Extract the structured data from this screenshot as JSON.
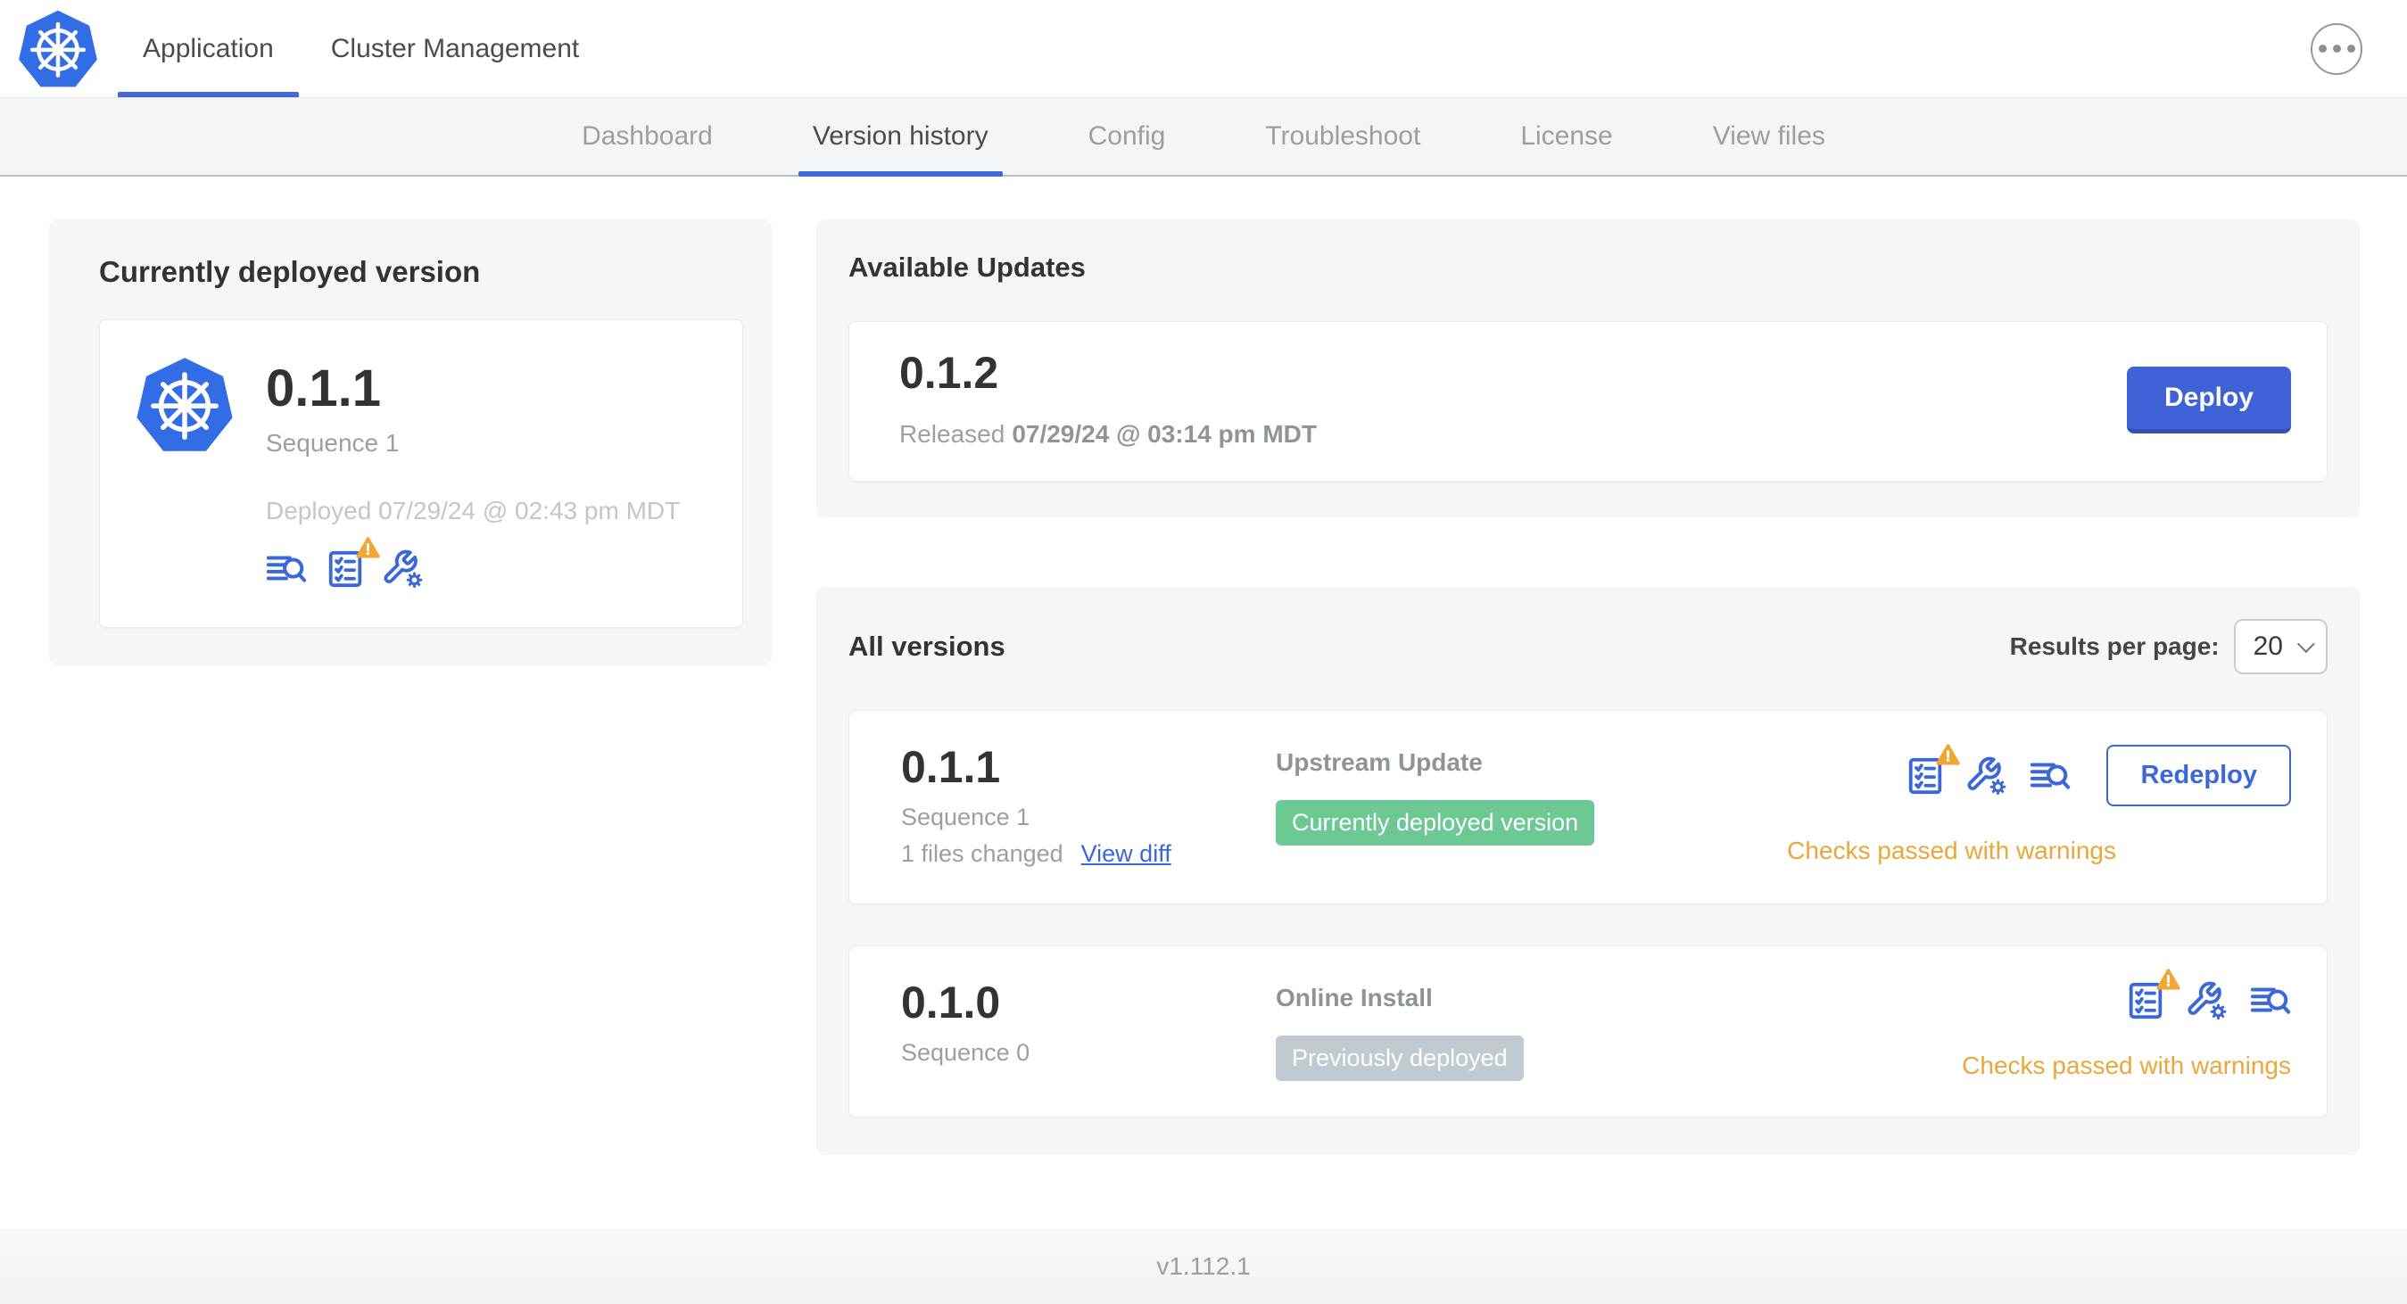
{
  "colors": {
    "accent_blue": "#3b68d9",
    "logo_blue": "#326de6",
    "warning_orange": "#eba63c",
    "triangle_orange": "#f0a733",
    "badge_green": "#6dc993",
    "badge_gray": "#c1cad0",
    "panel_gray": "#f5f6f8"
  },
  "header": {
    "tabs": [
      {
        "label": "Application",
        "active": true
      },
      {
        "label": "Cluster Management",
        "active": false
      }
    ],
    "menu_icon": "ellipsis-icon",
    "logo_icon": "kubernetes-logo"
  },
  "subnav": {
    "active": "Version history",
    "tabs": [
      {
        "label": "Dashboard"
      },
      {
        "label": "Version history"
      },
      {
        "label": "Config"
      },
      {
        "label": "Troubleshoot"
      },
      {
        "label": "License"
      },
      {
        "label": "View files"
      }
    ]
  },
  "current_version": {
    "title": "Currently deployed version",
    "version": "0.1.1",
    "sequence": "Sequence 1",
    "deployed": "Deployed 07/29/24 @ 02:43 pm MDT",
    "action_icons": [
      "view-logs-icon",
      "preflight-checks-warning-icon",
      "edit-config-icon"
    ]
  },
  "available_updates": {
    "title": "Available Updates",
    "version": "0.1.2",
    "released_label": "Released",
    "released_date": "07/29/24 @ 03:14 pm MDT",
    "deploy_label": "Deploy"
  },
  "all_versions": {
    "title": "All versions",
    "results_per_page_label": "Results per page:",
    "results_per_page_value": "20",
    "rows": [
      {
        "version": "0.1.1",
        "sequence": "Sequence 1",
        "files_changed": "1 files changed",
        "view_diff_label": "View diff",
        "source": "Upstream Update",
        "badge": "Currently deployed version",
        "badge_color": "#6dc993",
        "status": "Checks passed with warnings",
        "action_label": "Redeploy",
        "action_icons": [
          "preflight-checks-warning-icon",
          "edit-config-icon",
          "view-logs-icon"
        ]
      },
      {
        "version": "0.1.0",
        "sequence": "Sequence 0",
        "source": "Online Install",
        "badge": "Previously deployed",
        "badge_color": "#c1cad0",
        "status": "Checks passed with warnings",
        "action_icons": [
          "preflight-checks-warning-icon",
          "edit-config-icon",
          "view-logs-icon"
        ]
      }
    ]
  },
  "footer": {
    "version": "v1.112.1"
  }
}
